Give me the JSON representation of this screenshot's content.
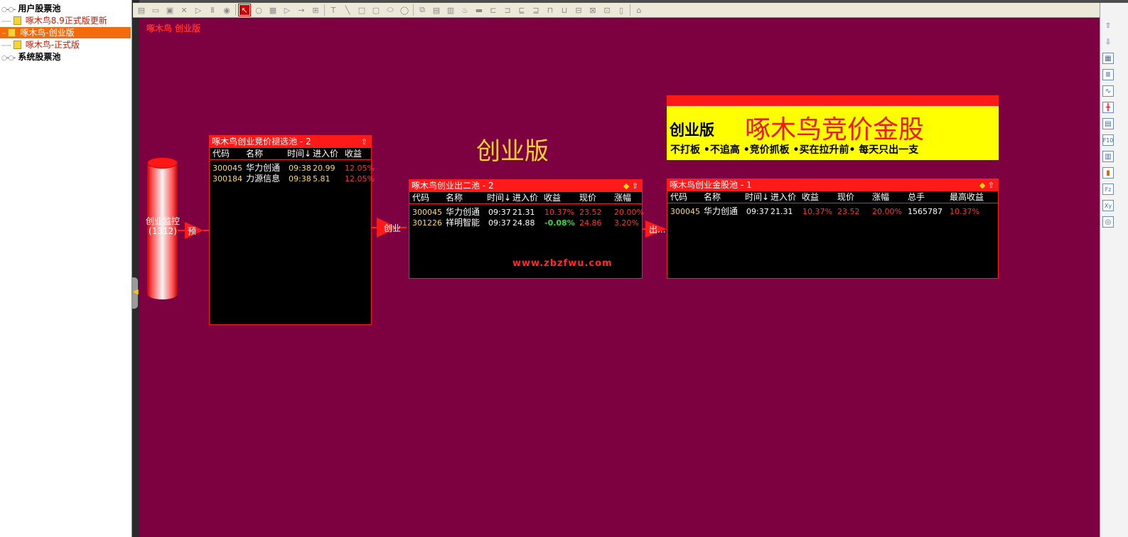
{
  "tree": {
    "user_pool": "用户股票池",
    "items": [
      "啄木鸟8.9正式版更新",
      "啄木鸟-创业版",
      "啄木鸟-正式版"
    ],
    "system_pool": "系统股票池"
  },
  "canvas": {
    "title": "啄木鸟 创业版",
    "center_label": "创业版",
    "cylinder": {
      "label": "创业监控",
      "count": "(1312)"
    },
    "arrows": {
      "a1": "预",
      "a2": "创业",
      "a3": "出..."
    },
    "watermark": "www.zbzfwu.com"
  },
  "panel1": {
    "title": "啄木鸟创业竞价褪选池 - 2",
    "cols": [
      "代码",
      "名称",
      "时间↓",
      "进入价",
      "收益"
    ],
    "rows": [
      {
        "code": "300045",
        "name": "华力创通",
        "time": "09:38",
        "price": "20.99",
        "ret": "12.05%"
      },
      {
        "code": "300184",
        "name": "力源信息",
        "time": "09:38",
        "price": "5.81",
        "ret": "12.05%"
      }
    ]
  },
  "panel2": {
    "title": "啄木鸟创业出二池 - 2",
    "cols": [
      "代码",
      "名称",
      "时间↓",
      "进入价",
      "收益",
      "现价",
      "涨幅"
    ],
    "rows": [
      {
        "code": "300045",
        "name": "华力创通",
        "time": "09:37",
        "price": "21.31",
        "ret": "10.37%",
        "now": "23.52",
        "chg": "20.00%"
      },
      {
        "code": "301226",
        "name": "祥明智能",
        "time": "09:37",
        "price": "24.88",
        "ret": "-0.08%",
        "now": "24.86",
        "chg": "3.20%"
      }
    ]
  },
  "panel3": {
    "title": "啄木鸟创业金股池 - 1",
    "cols": [
      "代码",
      "名称",
      "时间↓",
      "进入价",
      "收益",
      "现价",
      "涨幅",
      "总手",
      "最高收益"
    ],
    "rows": [
      {
        "code": "300045",
        "name": "华力创通",
        "time": "09:37",
        "price": "21.31",
        "ret": "10.37%",
        "now": "23.52",
        "chg": "20.00%",
        "vol": "1565787",
        "max": "10.37%"
      }
    ]
  },
  "banner": {
    "edition": "创业版",
    "title": "啄木鸟竞价金股",
    "slogans": "不打板 •不追高 •竞价抓板 •买在拉升前• 每天只出一支"
  },
  "colors": {
    "canvas_bg": "#7d0041",
    "accent": "#ff1a1a",
    "highlight": "#ffff00"
  }
}
